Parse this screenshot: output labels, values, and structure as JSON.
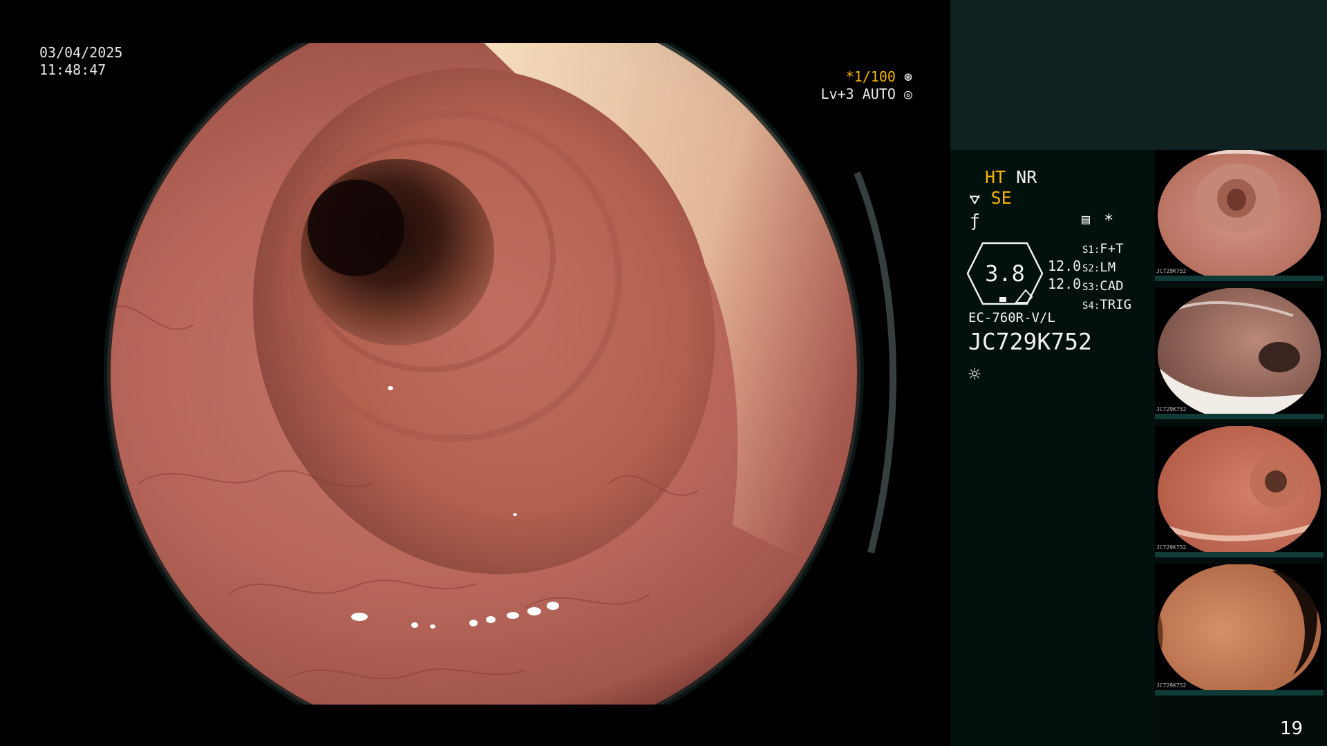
{
  "overlay": {
    "date": "03/04/2025",
    "time": "11:48:47",
    "shutter": "*1/100",
    "level_mode": "Lv+3 AUTO"
  },
  "panel": {
    "ht_label": "HT",
    "nr_label": "NR",
    "se_label": "SE",
    "zoom_value": "3.8",
    "aux_value_1": "12.0",
    "aux_value_2": "12.0",
    "switches": [
      {
        "key": "S1:",
        "value": "F+T"
      },
      {
        "key": "S2:",
        "value": "LM"
      },
      {
        "key": "S3:",
        "value": "CAD"
      },
      {
        "key": "S4:",
        "value": "TRIG"
      }
    ],
    "scope_model": "EC-760R-V/L",
    "scope_id": "JC729K752",
    "thumbnails": [
      {
        "caption": "JC729K752"
      },
      {
        "caption": "JC729K752"
      },
      {
        "caption": "JC729K752"
      },
      {
        "caption": "JC729K752"
      }
    ]
  },
  "page_number": "19",
  "colors": {
    "accent": "#f5b400",
    "panel_top": "#0f2221",
    "panel_bg": "#02100e",
    "mucosa": "#b8665a"
  }
}
